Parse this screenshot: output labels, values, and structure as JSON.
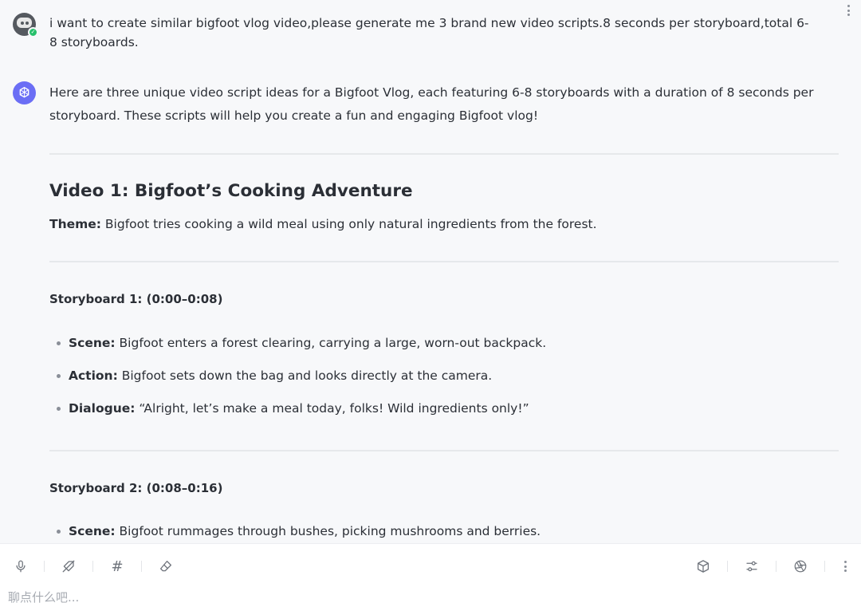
{
  "user_message": {
    "text": "i want to create similar bigfoot vlog video,please generate me 3 brand new video scripts.8 seconds per storyboard,total 6-8 storyboards."
  },
  "ai_message": {
    "intro": "Here are three unique video script ideas for a Bigfoot Vlog, each featuring 6-8 storyboards with a duration of 8 seconds per storyboard. These scripts will help you create a fun and engaging Bigfoot vlog!",
    "video1": {
      "title": "Video 1: Bigfoot’s Cooking Adventure",
      "theme_label": "Theme:",
      "theme_text": " Bigfoot tries cooking a wild meal using only natural ingredients from the forest."
    },
    "storyboards": [
      {
        "title": "Storyboard 1: (0:00–0:08)",
        "bullets": [
          {
            "label": "Scene:",
            "text": " Bigfoot enters a forest clearing, carrying a large, worn-out backpack."
          },
          {
            "label": "Action:",
            "text": " Bigfoot sets down the bag and looks directly at the camera."
          },
          {
            "label": "Dialogue:",
            "text": " “Alright, let’s make a meal today, folks! Wild ingredients only!”"
          }
        ]
      },
      {
        "title": "Storyboard 2: (0:08–0:16)",
        "bullets": [
          {
            "label": "Scene:",
            "text": " Bigfoot rummages through bushes, picking mushrooms and berries."
          }
        ]
      }
    ]
  },
  "composer": {
    "placeholder": "聊点什么吧...",
    "tools": [
      "microphone-icon",
      "no-tag-icon",
      "hash-icon",
      "eraser-icon",
      "cube-icon",
      "sliders-icon",
      "aperture-icon",
      "more-icon"
    ]
  },
  "colors": {
    "background": "#f7f8fa",
    "ai_avatar": "#6b6ef5",
    "user_badge": "#27c06b"
  }
}
